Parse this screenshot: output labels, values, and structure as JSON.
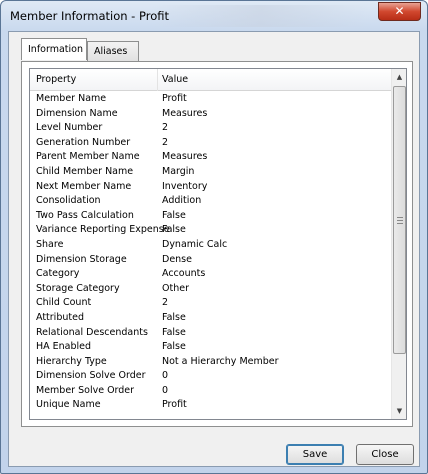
{
  "window": {
    "title": "Member Information - Profit",
    "close_glyph": "✕"
  },
  "tabs": [
    {
      "label": "Information"
    },
    {
      "label": "Aliases"
    }
  ],
  "grid": {
    "columns": [
      "Property",
      "Value"
    ],
    "rows": [
      {
        "property": "Member Name",
        "value": "Profit"
      },
      {
        "property": "Dimension Name",
        "value": "Measures"
      },
      {
        "property": "Level Number",
        "value": "2"
      },
      {
        "property": "Generation Number",
        "value": "2"
      },
      {
        "property": "Parent Member Name",
        "value": "Measures"
      },
      {
        "property": "Child Member Name",
        "value": "Margin"
      },
      {
        "property": "Next Member Name",
        "value": "Inventory"
      },
      {
        "property": "Consolidation",
        "value": "Addition"
      },
      {
        "property": "Two Pass Calculation",
        "value": "False"
      },
      {
        "property": "Variance Reporting Expense",
        "value": "False"
      },
      {
        "property": "Share",
        "value": "Dynamic Calc"
      },
      {
        "property": "Dimension Storage",
        "value": "Dense"
      },
      {
        "property": "Category",
        "value": "Accounts"
      },
      {
        "property": "Storage Category",
        "value": "Other"
      },
      {
        "property": "Child Count",
        "value": "2"
      },
      {
        "property": "Attributed",
        "value": "False"
      },
      {
        "property": "Relational Descendants",
        "value": "False"
      },
      {
        "property": "HA Enabled",
        "value": "False"
      },
      {
        "property": "Hierarchy Type",
        "value": "Not a Hierarchy Member"
      },
      {
        "property": "Dimension Solve Order",
        "value": "0"
      },
      {
        "property": "Member Solve Order",
        "value": "0"
      },
      {
        "property": "Unique Name",
        "value": "Profit"
      }
    ]
  },
  "buttons": {
    "save": "Save",
    "close": "Close"
  }
}
